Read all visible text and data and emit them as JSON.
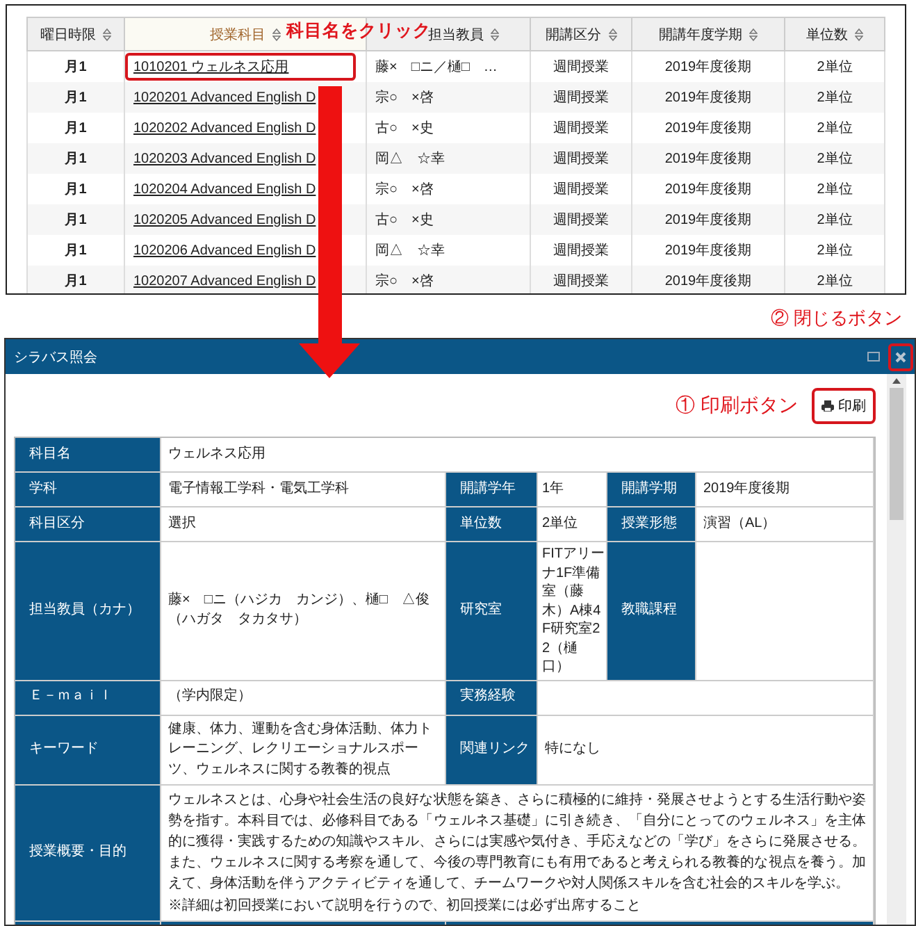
{
  "course_list": {
    "columns": [
      {
        "label": "曜日時限",
        "sorted": false
      },
      {
        "label": "授業科目",
        "sorted": true
      },
      {
        "label": "担当教員",
        "sorted": false
      },
      {
        "label": "開講区分",
        "sorted": false
      },
      {
        "label": "開講年度学期",
        "sorted": false
      },
      {
        "label": "単位数",
        "sorted": false
      }
    ],
    "rows": [
      {
        "period": "月1",
        "subject": "1010201 ウェルネス応用",
        "teachers": "藤×　□ニ／樋□　…",
        "type": "週間授業",
        "term": "2019年度後期",
        "credits": "2単位",
        "highlighted": true
      },
      {
        "period": "月1",
        "subject": "1020201 Advanced English D",
        "teachers": "宗○　×啓",
        "type": "週間授業",
        "term": "2019年度後期",
        "credits": "2単位",
        "highlighted": false
      },
      {
        "period": "月1",
        "subject": "1020202 Advanced English D",
        "teachers": "古○　×史",
        "type": "週間授業",
        "term": "2019年度後期",
        "credits": "2単位",
        "highlighted": false
      },
      {
        "period": "月1",
        "subject": "1020203 Advanced English D",
        "teachers": "岡△　☆幸",
        "type": "週間授業",
        "term": "2019年度後期",
        "credits": "2単位",
        "highlighted": false
      },
      {
        "period": "月1",
        "subject": "1020204 Advanced English D",
        "teachers": "宗○　×啓",
        "type": "週間授業",
        "term": "2019年度後期",
        "credits": "2単位",
        "highlighted": false
      },
      {
        "period": "月1",
        "subject": "1020205 Advanced English D",
        "teachers": "古○　×史",
        "type": "週間授業",
        "term": "2019年度後期",
        "credits": "2単位",
        "highlighted": false
      },
      {
        "period": "月1",
        "subject": "1020206 Advanced English D",
        "teachers": "岡△　☆幸",
        "type": "週間授業",
        "term": "2019年度後期",
        "credits": "2単位",
        "highlighted": false
      },
      {
        "period": "月1",
        "subject": "1020207 Advanced English D",
        "teachers": "宗○　×啓",
        "type": "週間授業",
        "term": "2019年度後期",
        "credits": "2単位",
        "highlighted": false
      }
    ]
  },
  "annotations": {
    "click_hint": "科目名をクリック",
    "close_hint": "②  閉じるボタン",
    "print_hint": "①  印刷ボタン"
  },
  "dialog": {
    "title": "シラバス照会",
    "print_button": "印刷",
    "rows": [
      {
        "cells": [
          {
            "kind": "label",
            "text": "科目名"
          },
          {
            "kind": "value",
            "text": "ウェルネス応用"
          }
        ]
      },
      {
        "cells": [
          {
            "kind": "label",
            "text": "学科"
          },
          {
            "kind": "value",
            "text": "電子情報工学科・電気工学科"
          },
          {
            "kind": "label",
            "text": "開講学年"
          },
          {
            "kind": "value",
            "text": "1年"
          },
          {
            "kind": "label",
            "text": "開講学期"
          },
          {
            "kind": "value",
            "text": "2019年度後期"
          }
        ]
      },
      {
        "cells": [
          {
            "kind": "label",
            "text": "科目区分"
          },
          {
            "kind": "value",
            "text": "選択"
          },
          {
            "kind": "label",
            "text": "単位数"
          },
          {
            "kind": "value",
            "text": "2単位"
          },
          {
            "kind": "label",
            "text": "授業形態"
          },
          {
            "kind": "value",
            "text": "演習（AL）"
          }
        ]
      },
      {
        "cells": [
          {
            "kind": "label",
            "text": "担当教員（カナ）"
          },
          {
            "kind": "value",
            "text": "藤×　□ニ（ハジカ　カンジ）、樋□　△俊（ハガタ　タカタサ）"
          },
          {
            "kind": "label",
            "text": "研究室"
          },
          {
            "kind": "value",
            "text": "FITアリーナ1F準備室（藤木）A棟4F研究室22（樋口）"
          },
          {
            "kind": "label",
            "text": "教職課程"
          },
          {
            "kind": "value"
          }
        ]
      },
      {
        "cells": [
          {
            "kind": "label",
            "text": "Ｅ－ｍａｉｌ"
          },
          {
            "kind": "value",
            "text": "（学内限定）"
          },
          {
            "kind": "label",
            "text": "実務経験"
          },
          {
            "kind": "value"
          }
        ]
      },
      {
        "cells": [
          {
            "kind": "label",
            "text": "キーワード"
          },
          {
            "kind": "value",
            "text": "健康、体力、運動を含む身体活動、体力トレーニング、レクリエーショナルスポーツ、ウェルネスに関する教養的視点"
          },
          {
            "kind": "label",
            "text": "関連リンク"
          },
          {
            "kind": "value",
            "text": "特になし"
          }
        ]
      },
      {
        "cells": [
          {
            "kind": "label",
            "text": "授業概要・目的"
          },
          {
            "kind": "value",
            "paragraphs": [
              "ウェルネスとは、心身や社会生活の良好な状態を築き、さらに積極的に維持・発展させようとする生活行動や姿勢を指す。本科目では、必修科目である「ウェルネス基礎」に引き続き、「自分にとってのウェルネス」を主体的に獲得・実践するための知識やスキル、さらには実感や気付き、手応えなどの「学び」をさらに発展させる。また、ウェルネスに関する考察を通して、今後の専門教育にも有用であると考えられる教養的な視点を養う。加えて、身体活動を伴うアクティビティを通して、チームワークや対人関係スキルを含む社会的スキルを学ぶ。",
              "※詳細は初回授業において説明を行うので、初回授業には必ず出席すること"
            ]
          }
        ]
      },
      {
        "cells": [
          {
            "kind": "label"
          },
          {
            "kind": "label"
          },
          {
            "kind": "label"
          }
        ]
      }
    ]
  }
}
